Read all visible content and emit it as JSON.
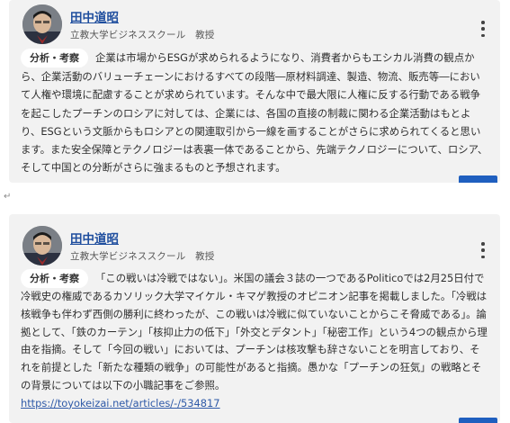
{
  "comments": [
    {
      "author": "田中道昭",
      "title": "立教大学ビジネススクール　教授",
      "tag": "分析・考察",
      "text": "企業は市場からESGが求められるようになり、消費者からもエシカル消費の観点から、企業活動のバリューチェーンにおけるすべての段階―原材料調達、製造、物流、販売等―において人権や環境に配慮することが求められています。そんな中で最大限に人権に反する行動である戦争を起こしたプーチンのロシアに対しては、企業には、各国の直接の制裁に関わる企業活動はもとより、ESGという文脈からもロシアとの関連取引から一線を画することがさらに求められてくると思います。また安全保障とテクノロジーは表裏一体であることから、先端テクノロジーについて、ロシア、そして中国との分断がさらに強まるものと予想されます。"
    },
    {
      "author": "田中道昭",
      "title": "立教大学ビジネススクール　教授",
      "tag": "分析・考察",
      "text": "「この戦いは冷戦ではない」。米国の議会３誌の一つであるPoliticoでは2月25日付で冷戦史の権威であるカソリック大学マイケル・キマゲ教授のオピニオン記事を掲載しました。「冷戦は核戦争も伴わず西側の勝利に終わったが、この戦いは冷戦に似ていないことからこそ脅威である」。論拠として、「鉄のカーテン」「核抑止力の低下」「外交とデタント」「秘密工作」という4つの観点から理由を指摘。そして「今回の戦い」においては、プーチンは核攻撃も辞さないことを明言しており、それを前提とした「新たな種類の戦争」の可能性があると指摘。愚かな「プーチンの狂気」の戦略とその背景については以下の小職記事をご参照。",
      "link": "https://toyokeizai.net/articles/-/534817"
    }
  ],
  "separator": "↵"
}
